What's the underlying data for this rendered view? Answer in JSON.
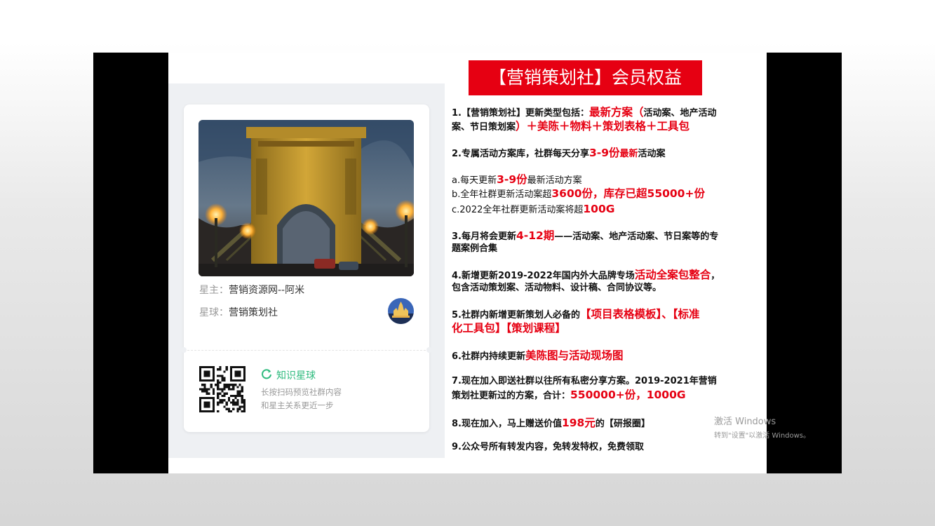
{
  "card": {
    "owner_key": "星主：",
    "owner_value": "营销资源网--阿米",
    "planet_key": "星球：",
    "planet_value": "营销策划社",
    "brand": "知识星球",
    "hint_line1": "长按扫码预览社群内容",
    "hint_line2": "和星主关系更近一步"
  },
  "title": "【营销策划社】会员权益",
  "benefits": {
    "i1": {
      "a": "1.【营销策划社】更新类型包括：",
      "b": "最新方案（",
      "c": "活动案、地产活动",
      "d": "案、节日策划案",
      "e": "）＋美陈＋物料＋策划表格＋工具包"
    },
    "i2": {
      "a": "2.专属活动方案库，社群每天分享",
      "b": "3-9份",
      "c": "最新",
      "d": "活动案"
    },
    "ia": {
      "a": "a.每天更新",
      "b": "3-9份",
      "c": "最新活动方案"
    },
    "ib": {
      "a": "b.全年社群更新活动案超",
      "b": "3600份，库存已超55000+份"
    },
    "ic": {
      "a": "c.2022全年社群更新活动案将超",
      "b": "100G"
    },
    "i3": {
      "a": "3.每月将会更新",
      "b": "4-12期",
      "c": "——活动案、地产活动案、节日案等的专",
      "d": "题案例合集"
    },
    "i4": {
      "a": "4.新增更新2019-2022年国内外大品牌专场",
      "b": "活动全案包整合",
      "c": "，",
      "d": "包含活动策划案、活动物料、设计稿、合同协议等。"
    },
    "i5": {
      "a": "5.社群内新增更新策划人必备的",
      "b": "【项目表格模板】、【标准",
      "c": "化工具包】【策划课程】"
    },
    "i6": {
      "a": "6.社群内持续更新",
      "b": "美陈图与活动现场图"
    },
    "i7": {
      "a": "7.现在加入即送社群以往所有私密分享方案。2019-2021年营销",
      "b": "策划社更新过的方案，合计：",
      "c": "550000+份，1000G"
    },
    "i8": {
      "a": "8.现在加入，马上赠送价值",
      "b": "198元",
      "c": "的【研报圈】"
    },
    "i9": {
      "a": "9.公众号所有转发内容，免转发特权，免费领取"
    }
  },
  "watermark": {
    "line1": "激活 Windows",
    "line2": "转到\"设置\"以激活 Windows。"
  },
  "colors": {
    "accent": "#e60012",
    "brand_green": "#2dba7d",
    "panel_bg": "#eef0f3"
  },
  "icons": {
    "brand": "refresh-ring-icon",
    "qr": "qr-code-icon"
  }
}
